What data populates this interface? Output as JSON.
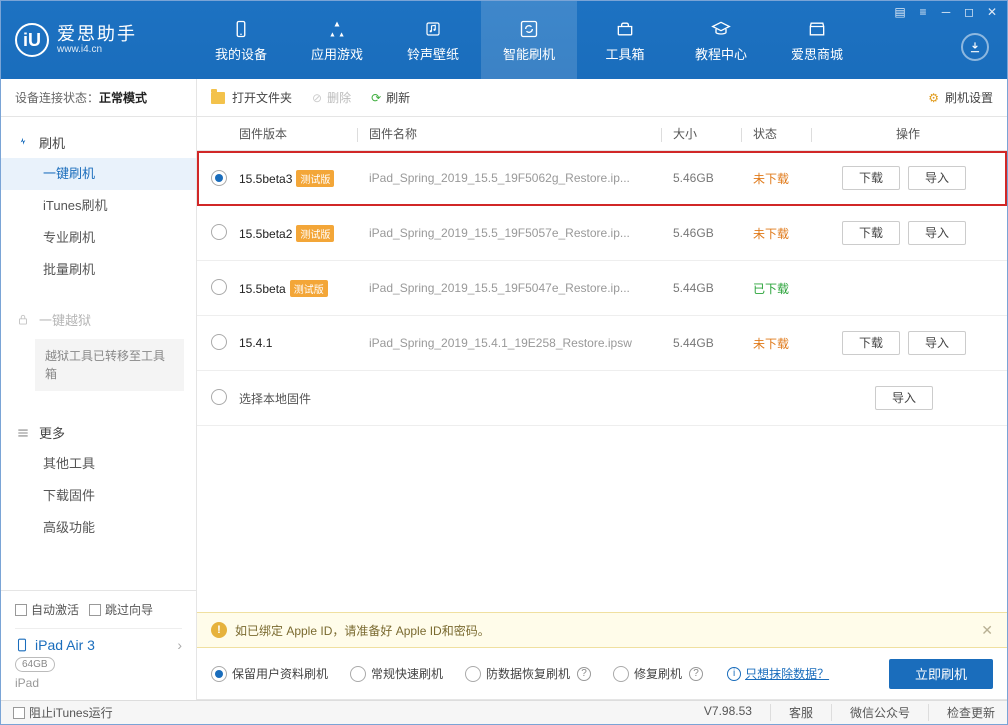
{
  "app": {
    "name": "爱思助手",
    "site": "www.i4.cn"
  },
  "topnav": {
    "items": [
      {
        "label": "我的设备"
      },
      {
        "label": "应用游戏"
      },
      {
        "label": "铃声壁纸"
      },
      {
        "label": "智能刷机"
      },
      {
        "label": "工具箱"
      },
      {
        "label": "教程中心"
      },
      {
        "label": "爱思商城"
      }
    ],
    "active_index": 3
  },
  "sidebar": {
    "conn_label": "设备连接状态：",
    "conn_value": "正常模式",
    "group1": {
      "title": "刷机",
      "items": [
        "一键刷机",
        "iTunes刷机",
        "专业刷机",
        "批量刷机"
      ]
    },
    "group2": {
      "title": "一键越狱",
      "note": "越狱工具已转移至工具箱"
    },
    "group3": {
      "title": "更多",
      "items": [
        "其他工具",
        "下载固件",
        "高级功能"
      ]
    },
    "auto_activate": "自动激活",
    "skip_guide": "跳过向导",
    "device_name": "iPad Air 3",
    "device_cap": "64GB",
    "device_type": "iPad"
  },
  "toolbar": {
    "open_folder": "打开文件夹",
    "delete": "删除",
    "refresh": "刷新",
    "settings": "刷机设置"
  },
  "table": {
    "headers": {
      "version": "固件版本",
      "name": "固件名称",
      "size": "大小",
      "status": "状态",
      "ops": "操作"
    },
    "rows": [
      {
        "version": "15.5beta3",
        "beta": "测试版",
        "name": "iPad_Spring_2019_15.5_19F5062g_Restore.ip...",
        "size": "5.46GB",
        "status_label": "未下载",
        "status_kind": "undl",
        "ops": [
          "下载",
          "导入"
        ],
        "selected": true
      },
      {
        "version": "15.5beta2",
        "beta": "测试版",
        "name": "iPad_Spring_2019_15.5_19F5057e_Restore.ip...",
        "size": "5.46GB",
        "status_label": "未下载",
        "status_kind": "undl",
        "ops": [
          "下载",
          "导入"
        ],
        "selected": false
      },
      {
        "version": "15.5beta",
        "beta": "测试版",
        "name": "iPad_Spring_2019_15.5_19F5047e_Restore.ip...",
        "size": "5.44GB",
        "status_label": "已下载",
        "status_kind": "dl",
        "ops": [],
        "selected": false
      },
      {
        "version": "15.4.1",
        "beta": null,
        "name": "iPad_Spring_2019_15.4.1_19E258_Restore.ipsw",
        "size": "5.44GB",
        "status_label": "未下载",
        "status_kind": "undl",
        "ops": [
          "下载",
          "导入"
        ],
        "selected": false
      }
    ],
    "local_row": {
      "label": "选择本地固件",
      "ops": [
        "导入"
      ]
    }
  },
  "tip": "如已绑定 Apple ID，请准备好 Apple ID和密码。",
  "options": {
    "items": [
      "保留用户资料刷机",
      "常规快速刷机",
      "防数据恢复刷机",
      "修复刷机"
    ],
    "selected_index": 0,
    "info_link": "只想抹除数据？",
    "go_button": "立即刷机"
  },
  "statusbar": {
    "stop_itunes": "阻止iTunes运行",
    "version": "V7.98.53",
    "svc": "客服",
    "wechat": "微信公众号",
    "update": "检查更新"
  }
}
